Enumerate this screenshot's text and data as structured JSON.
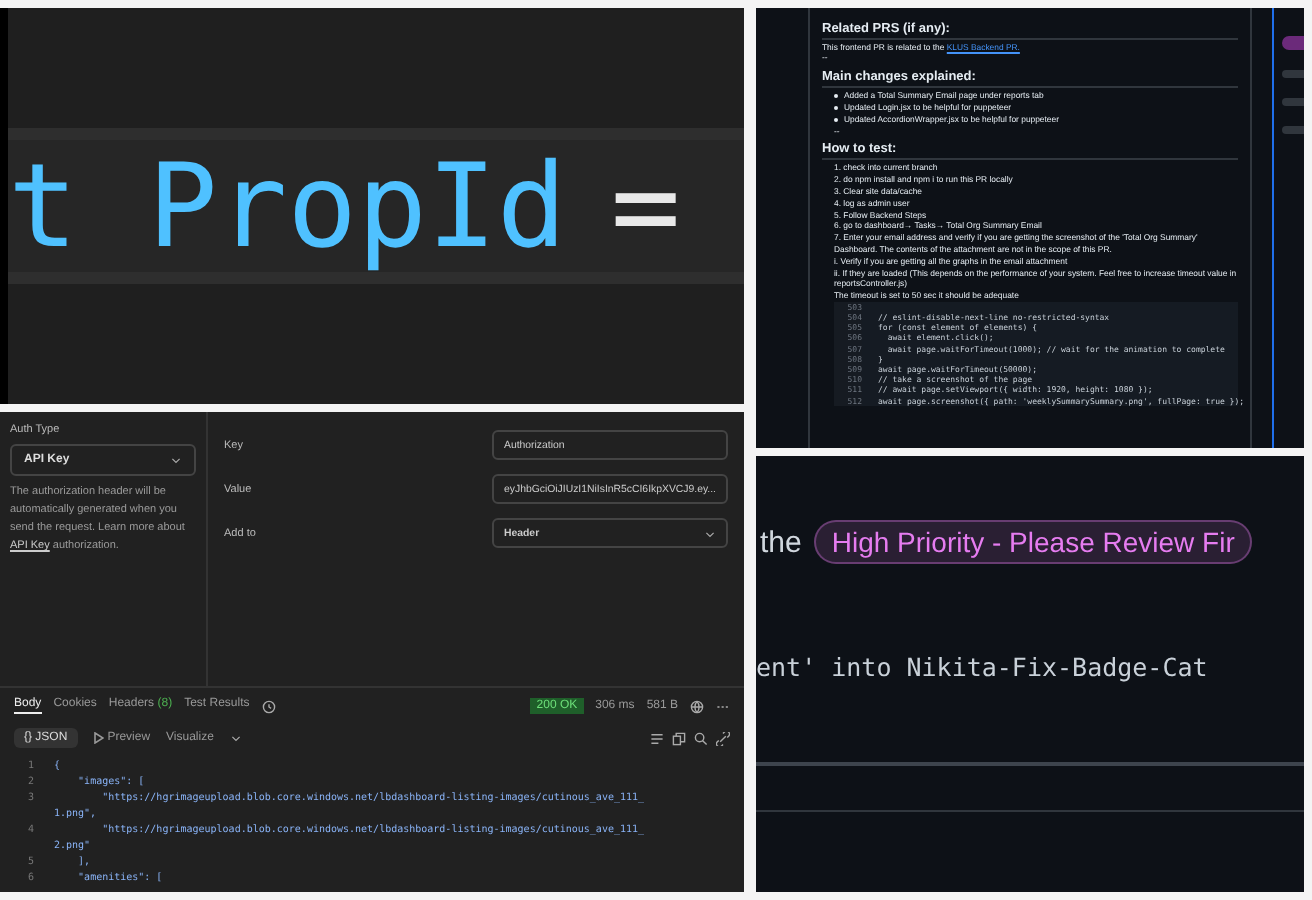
{
  "code_zoom": {
    "tokens": [
      {
        "kind": "identifier",
        "text": "t PropId"
      },
      {
        "kind": "operator",
        "text": "="
      }
    ]
  },
  "pull_request": {
    "sections": [
      {
        "kind": "heading",
        "text": "Related PRS (if any):"
      },
      {
        "kind": "paragraph",
        "text": "This frontend PR is related to the",
        "link": "KLUS Backend PR."
      },
      {
        "kind": "plain",
        "text": "--"
      },
      {
        "kind": "heading",
        "text": "Main changes explained:"
      },
      {
        "kind": "bullets",
        "items": [
          "Added a Total Summary Email page under reports tab",
          "Updated Login.jsx to be helpful for puppeteer",
          "Updated AccordionWrapper.jsx to be helpful for puppeteer"
        ],
        "trailer": "--"
      },
      {
        "kind": "heading",
        "text": "How to test:"
      },
      {
        "kind": "steps",
        "items": [
          "1. check into current branch",
          "2. do npm install and npm i to run this PR locally",
          "3. Clear site data/cache",
          "4. log as admin user",
          "5. Follow Backend Steps",
          "6. go to dashboard→ Tasks→ Total Org Summary Email",
          "7. Enter your email address and verify if you are getting the screenshot of the 'Total Org Summary' Dashboard. The contents of the attachment are not in the scope of this PR.",
          "i. Verify if you are getting all the graphs in the email attachment",
          "ii. If they are loaded (This depends on the performance of your system. Feel free to increase timeout value in reportsController.js)",
          "The timeout is set to 50 sec it should be adequate"
        ]
      },
      {
        "kind": "code",
        "lines": [
          {
            "number": "503"
          },
          {
            "number": "504",
            "text": "// eslint-disable-next-line no-restricted-syntax"
          },
          {
            "number": "505",
            "text": "for (const element of elements) {"
          },
          {
            "number": "506",
            "text": "  await element.click();"
          },
          {
            "number": "507",
            "text": "  await page.waitForTimeout(1000); // wait for the animation to complete"
          },
          {
            "number": "508",
            "text": "}"
          },
          {
            "number": "509",
            "text": "await page.waitForTimeout(50000);"
          },
          {
            "number": "510",
            "text": "// take a screenshot of the page"
          },
          {
            "number": "511",
            "text": "// await page.setViewport({ width: 1920, height: 1080 });"
          },
          {
            "number": "512",
            "text": "await page.screenshot({ path: 'weeklySummarySummary.png', fullPage: true });"
          }
        ]
      }
    ]
  },
  "api_client": {
    "auth_type": {
      "label": "Auth Type",
      "value": "API Key",
      "description": "The authorization header will be automatically generated when you send the request. Learn more about",
      "link": "API Key",
      "description_end": "authorization."
    },
    "fields": [
      {
        "kind": "input",
        "label": "Key",
        "value": "Authorization"
      },
      {
        "kind": "input",
        "label": "Value",
        "value": "eyJhbGciOiJIUzI1NiIsInR5cCI6IkpXVCJ9.ey..."
      },
      {
        "kind": "select",
        "label": "Add to",
        "value": "Header"
      }
    ],
    "response_tabs": [
      {
        "label": "Body",
        "selected": true
      },
      {
        "label": "Cookies",
        "selected": false
      },
      {
        "label": "Headers",
        "count": "(8)",
        "selected": false
      },
      {
        "label": "Test Results",
        "selected": false
      }
    ],
    "status": "200 OK",
    "time": "306 ms",
    "size": "581 B",
    "format": "{} JSON",
    "preview": "Preview",
    "visualize": "Visualize",
    "body_lines": [
      {
        "number": "1",
        "text": "{"
      },
      {
        "number": "2",
        "text": "    \"images\": ["
      },
      {
        "number": "3",
        "text": "        \"https://hgrimageupload.blob.core.windows.net/lbdashboard-listing-images/cutinous_ave_111_1.png\","
      },
      {
        "number": "4",
        "text": "        \"https://hgrimageupload.blob.core.windows.net/lbdashboard-listing-images/cutinous_ave_111_2.png\""
      },
      {
        "number": "5",
        "text": "    ],"
      },
      {
        "number": "6",
        "text": "    \"amenities\": ["
      }
    ]
  },
  "comment": {
    "lead": "the",
    "label": "High Priority - Please Review Fir",
    "commit": "ent' into Nikita-Fix-Badge-Cat"
  }
}
